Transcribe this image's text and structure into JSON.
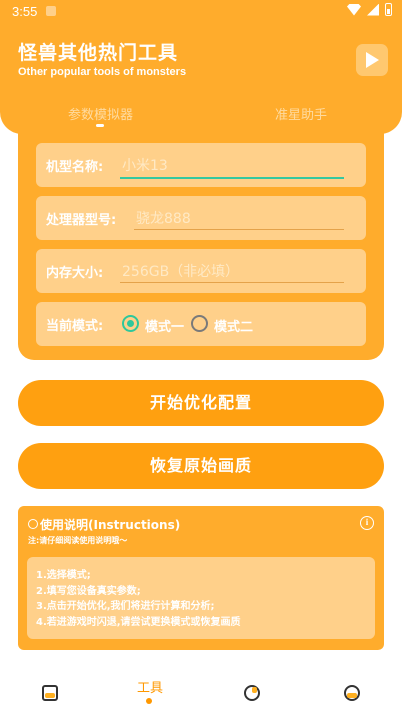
{
  "status_bar": {
    "time": "3:55"
  },
  "header": {
    "title": "怪兽其他热门工具",
    "subtitle": "Other popular tools of monsters",
    "play_icon": "play-icon"
  },
  "tabs": [
    {
      "label": "参数模拟器",
      "active": true
    },
    {
      "label": "准星助手",
      "active": false
    }
  ],
  "form": {
    "model_label": "机型名称:",
    "model_value": "小米13",
    "cpu_label": "处理器型号:",
    "cpu_value": "骁龙888",
    "ram_label": "内存大小:",
    "ram_placeholder": "256GB（非必填）",
    "mode_label": "当前模式:",
    "mode_options": [
      "模式一",
      "模式二"
    ],
    "mode_selected": "模式一"
  },
  "buttons": {
    "optimize": "开始优化配置",
    "restore": "恢复原始画质"
  },
  "instructions": {
    "title": "使用说明(Instructions)",
    "note": "注:请仔细阅读使用说明哦～",
    "steps": [
      "1.选择模式;",
      "2.填写您设备真实参数;",
      "3.点击开始优化,我们将进行计算和分析;",
      "4.若进游戏时闪退,请尝试更换模式或恢复画质"
    ]
  },
  "bottom_nav": {
    "items": [
      "home-icon",
      "工具",
      "chart-icon",
      "profile-icon"
    ],
    "active_label": "工具"
  },
  "colors": {
    "primary": "#ffac2c",
    "button": "#ffa010",
    "field": "#ffd08a",
    "accent_green": "#2fc79b"
  }
}
